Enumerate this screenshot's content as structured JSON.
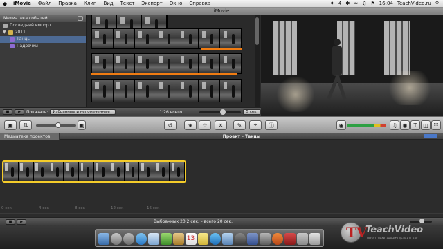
{
  "menubar": {
    "apple": "",
    "app_name": "iMovie",
    "items": [
      "Файл",
      "Правка",
      "Клип",
      "Вид",
      "Текст",
      "Экспорт",
      "Окно",
      "Справка"
    ],
    "status_num": "4",
    "clock": "16:04",
    "site": "TeachVideo.ru"
  },
  "window": {
    "title": "iMovie"
  },
  "library": {
    "header": "Медиатека событий",
    "items": [
      {
        "label": "Последний импорт"
      },
      {
        "label": "2011"
      },
      {
        "label": "Танцы"
      },
      {
        "label": "Падрочки"
      }
    ]
  },
  "event_footer": {
    "show_label": "Показать:",
    "show_value": "Избранные и непомеченные",
    "total": "1:26 всего",
    "duration": "5 сек."
  },
  "project": {
    "library_label": "Медиатека проектов",
    "title": "Проект – Танцы",
    "ruler": [
      "0 сек",
      "4 сек",
      "8 сек",
      "12 сек",
      "16 сек"
    ],
    "status": "Выбранных 20,2 сек. – всего 20 сек."
  },
  "watermark": {
    "letter": "TV",
    "brand": "TeachVideo",
    "slogan": "ПРОСТО КАК ЗНАНИЯ ДЕЛАЮТ ВАС"
  },
  "colors": {
    "selection": "#4d6a94",
    "clip_border": "#f4cc2a",
    "marker_orange": "#f07c12",
    "playhead": "#b33333"
  }
}
